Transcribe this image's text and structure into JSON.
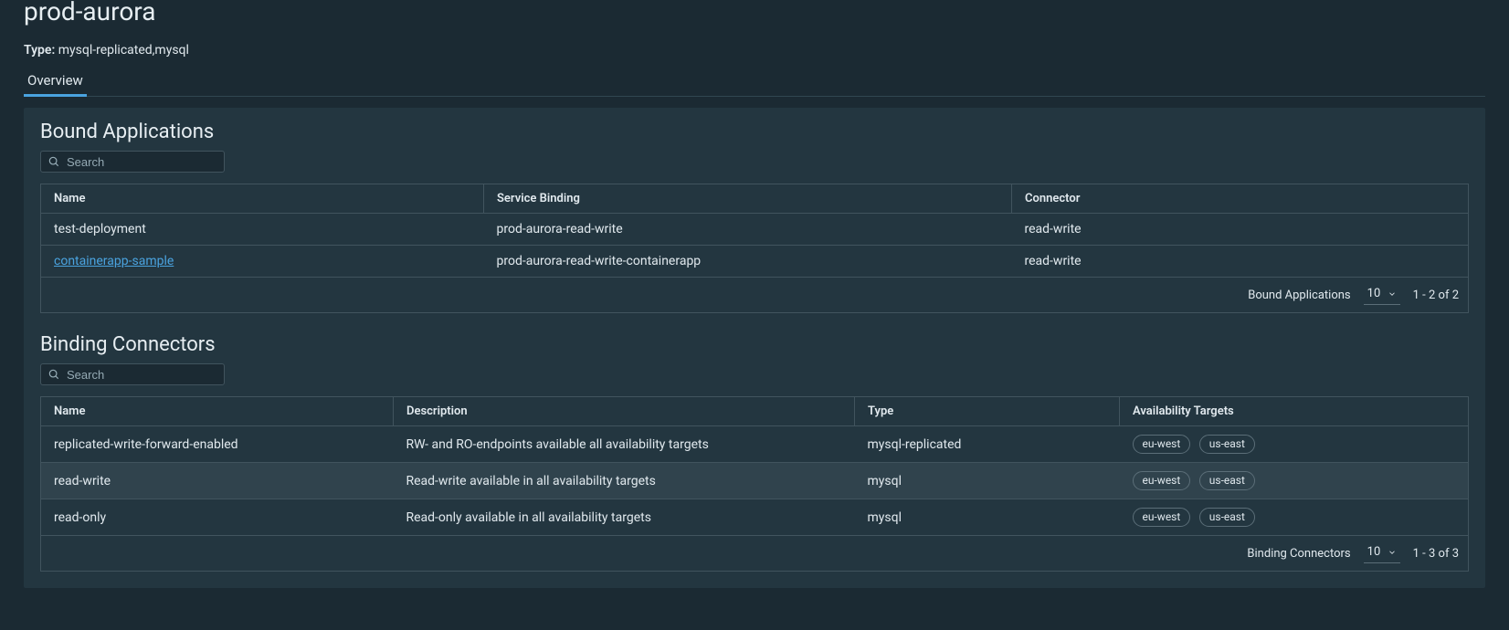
{
  "page_title": "prod-aurora",
  "type_label": "Type:",
  "type_value": "mysql-replicated,mysql",
  "tabs": [
    {
      "label": "Overview",
      "active": true
    }
  ],
  "search_placeholder": "Search",
  "sections": {
    "bound_apps": {
      "title": "Bound Applications",
      "columns": [
        "Name",
        "Service Binding",
        "Connector"
      ],
      "rows": [
        {
          "name": "test-deployment",
          "link": false,
          "service_binding": "prod-aurora-read-write",
          "connector": "read-write"
        },
        {
          "name": "containerapp-sample",
          "link": true,
          "service_binding": "prod-aurora-read-write-containerapp",
          "connector": "read-write"
        }
      ],
      "footer": {
        "label": "Bound Applications",
        "page_size": "10",
        "range": "1 - 2 of 2"
      }
    },
    "binding_connectors": {
      "title": "Binding Connectors",
      "columns": [
        "Name",
        "Description",
        "Type",
        "Availability Targets"
      ],
      "rows": [
        {
          "name": "replicated-write-forward-enabled",
          "desc": "RW- and RO-endpoints available all availability targets",
          "type": "mysql-replicated",
          "targets": [
            "eu-west",
            "us-east"
          ],
          "highlight": false
        },
        {
          "name": "read-write",
          "desc": "Read-write available in all availability targets",
          "type": "mysql",
          "targets": [
            "eu-west",
            "us-east"
          ],
          "highlight": true
        },
        {
          "name": "read-only",
          "desc": "Read-only available in all availability targets",
          "type": "mysql",
          "targets": [
            "eu-west",
            "us-east"
          ],
          "highlight": false
        }
      ],
      "footer": {
        "label": "Binding Connectors",
        "page_size": "10",
        "range": "1 - 3 of 3"
      }
    }
  }
}
